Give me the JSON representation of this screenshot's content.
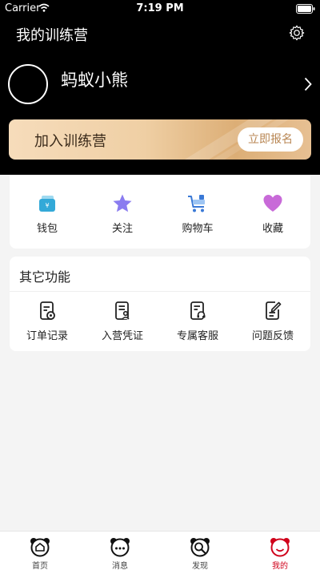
{
  "status": {
    "carrier": "Carrier",
    "time": "7:19 PM"
  },
  "header": {
    "title": "我的训练营"
  },
  "profile": {
    "name": "蚂蚁小熊"
  },
  "banner": {
    "text": "加入训练营",
    "button": "立即报名"
  },
  "quick": [
    {
      "label": "钱包",
      "icon": "wallet-icon"
    },
    {
      "label": "关注",
      "icon": "star-icon"
    },
    {
      "label": "购物车",
      "icon": "cart-icon"
    },
    {
      "label": "收藏",
      "icon": "heart-icon"
    }
  ],
  "other": {
    "title": "其它功能",
    "items": [
      {
        "label": "订单记录",
        "icon": "order-record-icon"
      },
      {
        "label": "入营凭证",
        "icon": "certificate-icon"
      },
      {
        "label": "专属客服",
        "icon": "customer-service-icon"
      },
      {
        "label": "问题反馈",
        "icon": "feedback-icon"
      }
    ]
  },
  "tabs": [
    {
      "label": "首页",
      "icon": "home-panda-icon"
    },
    {
      "label": "消息",
      "icon": "message-panda-icon"
    },
    {
      "label": "发现",
      "icon": "discover-panda-icon"
    },
    {
      "label": "我的",
      "icon": "mine-panda-icon",
      "active": true
    }
  ],
  "colors": {
    "accent": "#d0021b",
    "gold": "#b88653",
    "star": "#8a7cf0",
    "heart": "#c86ad8",
    "wallet": "#33a9d8"
  }
}
